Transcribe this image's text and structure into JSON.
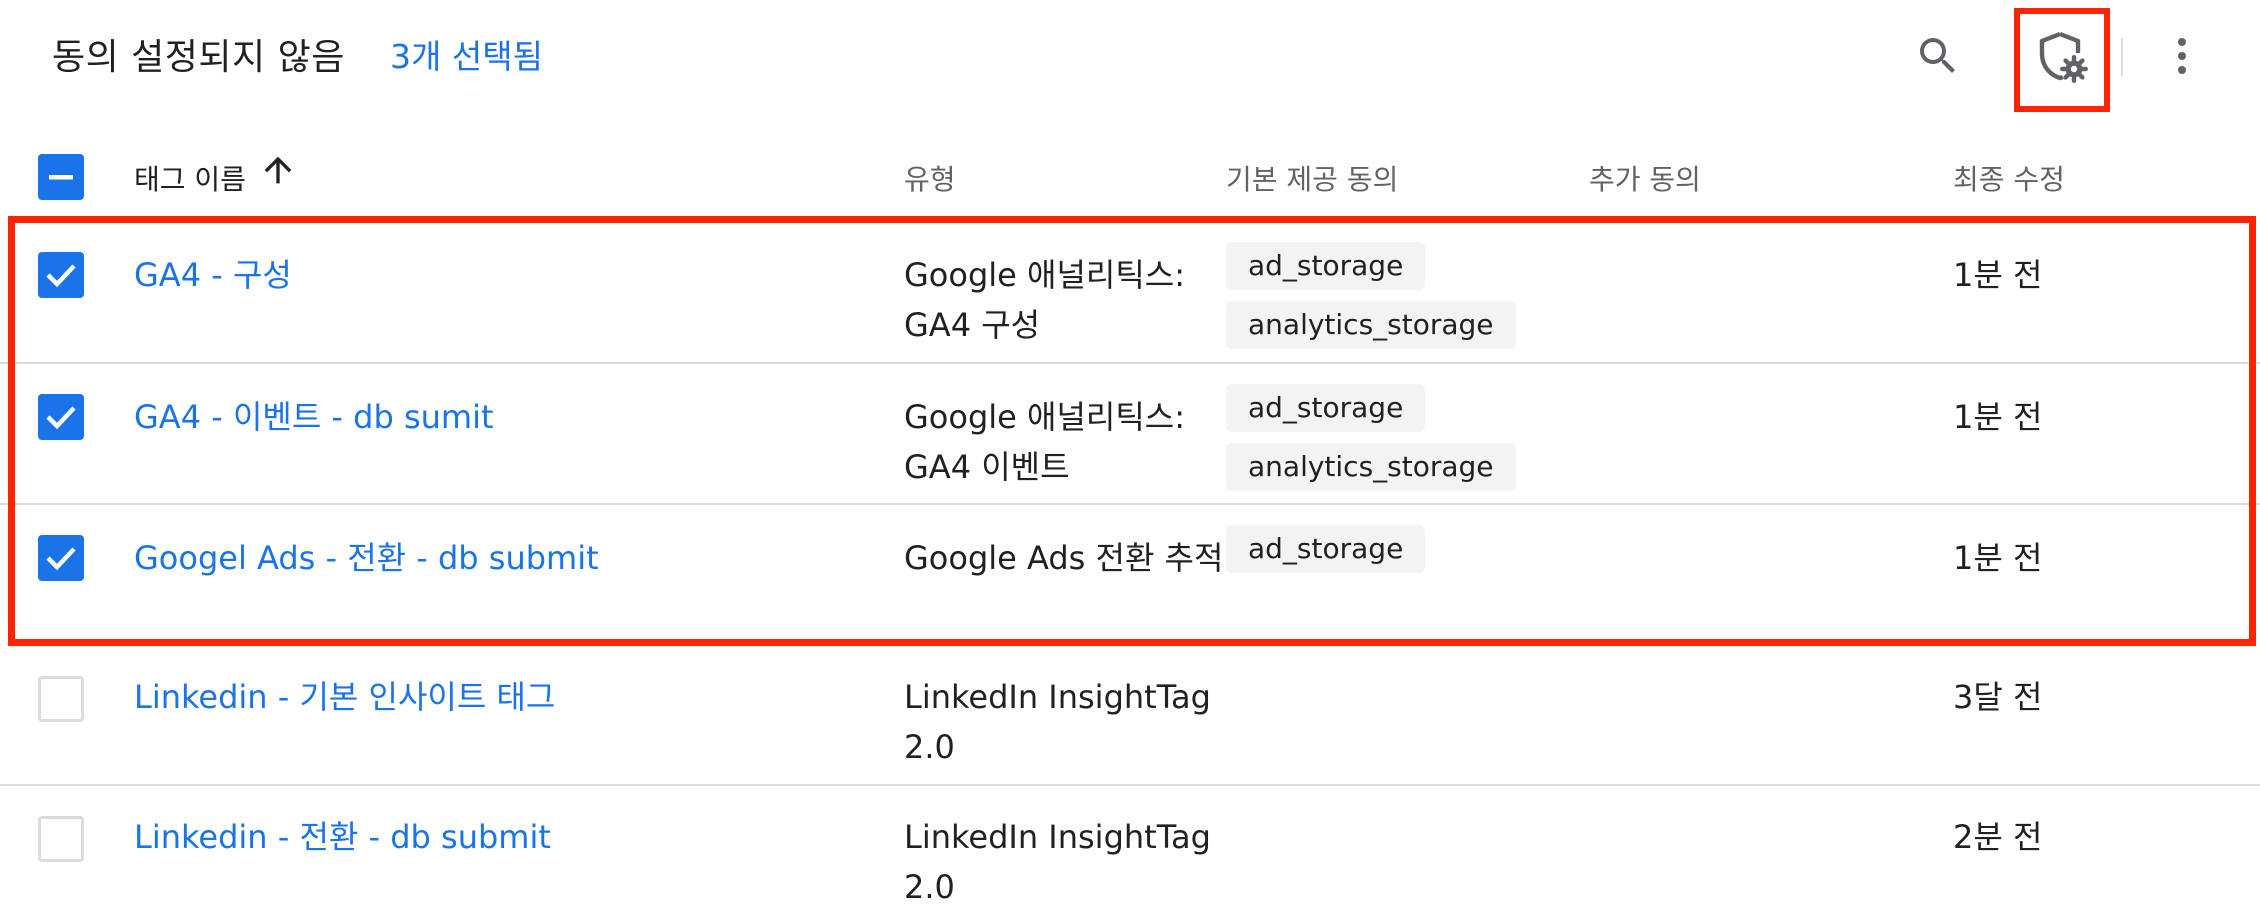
{
  "header": {
    "title": "동의 설정되지 않음",
    "selected_count": "3개 선택됨",
    "icons": [
      "search-icon",
      "consent-settings-icon",
      "more-vert-icon"
    ]
  },
  "table": {
    "columns": {
      "name": "태그 이름",
      "type": "유형",
      "base_consent": "기본 제공 동의",
      "extra_consent": "추가 동의",
      "last_modified": "최종 수정"
    },
    "sort": "ascending",
    "rows": [
      {
        "checked": true,
        "name": "GA4 - 구성",
        "type": "Google 애널리틱스: GA4 구성",
        "base_consent": [
          "ad_storage",
          "analytics_storage"
        ],
        "extra_consent": "",
        "last_modified": "1분 전"
      },
      {
        "checked": true,
        "name": "GA4 - 이벤트 - db sumit",
        "type": "Google 애널리틱스: GA4 이벤트",
        "base_consent": [
          "ad_storage",
          "analytics_storage"
        ],
        "extra_consent": "",
        "last_modified": "1분 전"
      },
      {
        "checked": true,
        "name": "Googel Ads - 전환 - db submit",
        "type": "Google Ads 전환 추적",
        "base_consent": [
          "ad_storage"
        ],
        "extra_consent": "",
        "last_modified": "1분 전"
      },
      {
        "checked": false,
        "name": "Linkedin - 기본 인사이트 태그",
        "type": "LinkedIn InsightTag 2.0",
        "base_consent": [],
        "extra_consent": "",
        "last_modified": "3달 전"
      },
      {
        "checked": false,
        "name": "Linkedin - 전환 - db submit",
        "type": "LinkedIn InsightTag 2.0",
        "base_consent": [],
        "extra_consent": "",
        "last_modified": "2분 전"
      }
    ]
  },
  "colors": {
    "accent": "#1a73e8",
    "highlight": "#ff2400",
    "chip_bg": "#f1f3f4",
    "divider": "#dadce0"
  }
}
